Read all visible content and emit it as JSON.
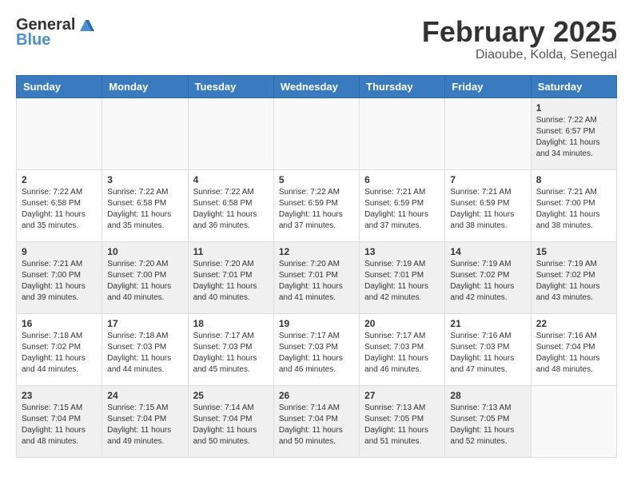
{
  "header": {
    "logo_general": "General",
    "logo_blue": "Blue",
    "month_year": "February 2025",
    "location": "Diaoube, Kolda, Senegal"
  },
  "weekdays": [
    "Sunday",
    "Monday",
    "Tuesday",
    "Wednesday",
    "Thursday",
    "Friday",
    "Saturday"
  ],
  "weeks": [
    [
      {
        "day": "",
        "info": ""
      },
      {
        "day": "",
        "info": ""
      },
      {
        "day": "",
        "info": ""
      },
      {
        "day": "",
        "info": ""
      },
      {
        "day": "",
        "info": ""
      },
      {
        "day": "",
        "info": ""
      },
      {
        "day": "1",
        "info": "Sunrise: 7:22 AM\nSunset: 6:57 PM\nDaylight: 11 hours\nand 34 minutes."
      }
    ],
    [
      {
        "day": "2",
        "info": "Sunrise: 7:22 AM\nSunset: 6:58 PM\nDaylight: 11 hours\nand 35 minutes."
      },
      {
        "day": "3",
        "info": "Sunrise: 7:22 AM\nSunset: 6:58 PM\nDaylight: 11 hours\nand 35 minutes."
      },
      {
        "day": "4",
        "info": "Sunrise: 7:22 AM\nSunset: 6:58 PM\nDaylight: 11 hours\nand 36 minutes."
      },
      {
        "day": "5",
        "info": "Sunrise: 7:22 AM\nSunset: 6:59 PM\nDaylight: 11 hours\nand 37 minutes."
      },
      {
        "day": "6",
        "info": "Sunrise: 7:21 AM\nSunset: 6:59 PM\nDaylight: 11 hours\nand 37 minutes."
      },
      {
        "day": "7",
        "info": "Sunrise: 7:21 AM\nSunset: 6:59 PM\nDaylight: 11 hours\nand 38 minutes."
      },
      {
        "day": "8",
        "info": "Sunrise: 7:21 AM\nSunset: 7:00 PM\nDaylight: 11 hours\nand 38 minutes."
      }
    ],
    [
      {
        "day": "9",
        "info": "Sunrise: 7:21 AM\nSunset: 7:00 PM\nDaylight: 11 hours\nand 39 minutes."
      },
      {
        "day": "10",
        "info": "Sunrise: 7:20 AM\nSunset: 7:00 PM\nDaylight: 11 hours\nand 40 minutes."
      },
      {
        "day": "11",
        "info": "Sunrise: 7:20 AM\nSunset: 7:01 PM\nDaylight: 11 hours\nand 40 minutes."
      },
      {
        "day": "12",
        "info": "Sunrise: 7:20 AM\nSunset: 7:01 PM\nDaylight: 11 hours\nand 41 minutes."
      },
      {
        "day": "13",
        "info": "Sunrise: 7:19 AM\nSunset: 7:01 PM\nDaylight: 11 hours\nand 42 minutes."
      },
      {
        "day": "14",
        "info": "Sunrise: 7:19 AM\nSunset: 7:02 PM\nDaylight: 11 hours\nand 42 minutes."
      },
      {
        "day": "15",
        "info": "Sunrise: 7:19 AM\nSunset: 7:02 PM\nDaylight: 11 hours\nand 43 minutes."
      }
    ],
    [
      {
        "day": "16",
        "info": "Sunrise: 7:18 AM\nSunset: 7:02 PM\nDaylight: 11 hours\nand 44 minutes."
      },
      {
        "day": "17",
        "info": "Sunrise: 7:18 AM\nSunset: 7:03 PM\nDaylight: 11 hours\nand 44 minutes."
      },
      {
        "day": "18",
        "info": "Sunrise: 7:17 AM\nSunset: 7:03 PM\nDaylight: 11 hours\nand 45 minutes."
      },
      {
        "day": "19",
        "info": "Sunrise: 7:17 AM\nSunset: 7:03 PM\nDaylight: 11 hours\nand 46 minutes."
      },
      {
        "day": "20",
        "info": "Sunrise: 7:17 AM\nSunset: 7:03 PM\nDaylight: 11 hours\nand 46 minutes."
      },
      {
        "day": "21",
        "info": "Sunrise: 7:16 AM\nSunset: 7:03 PM\nDaylight: 11 hours\nand 47 minutes."
      },
      {
        "day": "22",
        "info": "Sunrise: 7:16 AM\nSunset: 7:04 PM\nDaylight: 11 hours\nand 48 minutes."
      }
    ],
    [
      {
        "day": "23",
        "info": "Sunrise: 7:15 AM\nSunset: 7:04 PM\nDaylight: 11 hours\nand 48 minutes."
      },
      {
        "day": "24",
        "info": "Sunrise: 7:15 AM\nSunset: 7:04 PM\nDaylight: 11 hours\nand 49 minutes."
      },
      {
        "day": "25",
        "info": "Sunrise: 7:14 AM\nSunset: 7:04 PM\nDaylight: 11 hours\nand 50 minutes."
      },
      {
        "day": "26",
        "info": "Sunrise: 7:14 AM\nSunset: 7:04 PM\nDaylight: 11 hours\nand 50 minutes."
      },
      {
        "day": "27",
        "info": "Sunrise: 7:13 AM\nSunset: 7:05 PM\nDaylight: 11 hours\nand 51 minutes."
      },
      {
        "day": "28",
        "info": "Sunrise: 7:13 AM\nSunset: 7:05 PM\nDaylight: 11 hours\nand 52 minutes."
      },
      {
        "day": "",
        "info": ""
      }
    ]
  ]
}
